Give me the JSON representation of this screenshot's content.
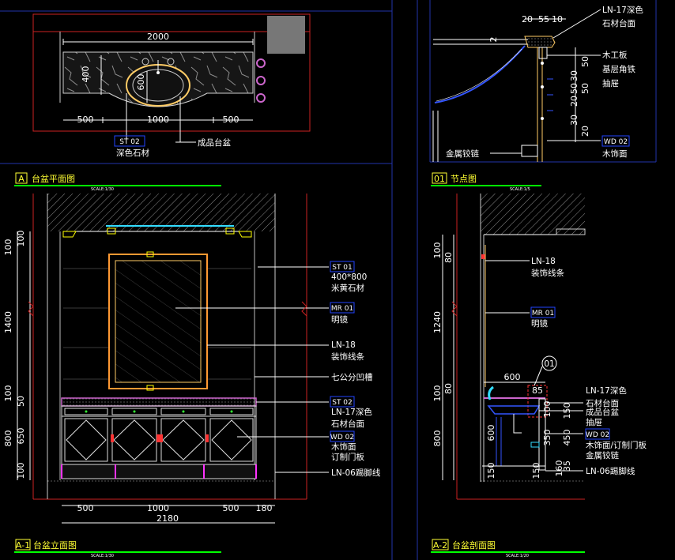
{
  "colors": {
    "background": "#000000",
    "frame": "#2233aa",
    "dimension": "#ffffff",
    "red_line": "#cc2222",
    "tag_box": "#2244ff",
    "title": "#ffff33",
    "title_underline": "#00ff00",
    "countertop": "#cc66cc",
    "accent": "#ffff00"
  },
  "plan": {
    "dims": {
      "width": "2000",
      "depth": "600",
      "side": "400",
      "left": "500",
      "mid": "1000",
      "right": "500"
    },
    "tags": {
      "stone": "ST 02",
      "stone_desc": "深色石材",
      "basin_desc": "成品台盆"
    },
    "title": {
      "id": "A",
      "text": "台盆平面图",
      "scale": "SCALE:1/30"
    }
  },
  "node": {
    "top_dims": [
      "20",
      "55",
      "10"
    ],
    "side_dims": [
      "50",
      "30",
      "50",
      "20",
      "50",
      "30",
      "20"
    ],
    "labels": {
      "top_stone": "LN-17深色",
      "top_stone2": "石材台面",
      "wood": "木工板",
      "angle": "基层角铁",
      "drawer": "抽屉",
      "hinge": "金属铰链",
      "wd_tag": "WD 02",
      "wd_desc": "木饰面",
      "left_dim": "2"
    },
    "title": {
      "id": "01",
      "text": "节点图",
      "scale": "SCALE:1/5"
    }
  },
  "elevation": {
    "vdims_outer": [
      "100",
      "1400",
      "100",
      "800"
    ],
    "vdims_inner": [
      "100",
      "50",
      "650",
      "100"
    ],
    "bottom_dims": [
      "500",
      "1000",
      "500",
      "180"
    ],
    "total": "2180",
    "tags": {
      "st01": "ST 01",
      "st01_size": "400*800",
      "st01_desc": "米黄石材",
      "mr01": "MR 01",
      "mr01_desc": "明镜",
      "ln18": "LN-18",
      "ln18_desc": "装饰线条",
      "groove": "七公分凹槽",
      "st02": "ST 02",
      "st02_desc1": "LN-17深色",
      "st02_desc2": "石材台面",
      "wd02": "WD 02",
      "wd02_desc1": "木饰面",
      "wd02_desc2": "订制门板",
      "kick": "LN-06踢脚线"
    },
    "title": {
      "id": "A-1",
      "text": "台盆立面图",
      "scale": "SCALE:1/30"
    }
  },
  "section": {
    "vdims_outer": [
      "100",
      "1240",
      "100",
      "800"
    ],
    "vdims_inner": [
      "80",
      "80",
      "600",
      "150"
    ],
    "inner_dims": [
      "85",
      "100",
      "350",
      "450",
      "150",
      "150",
      "160",
      "35"
    ],
    "width_dim": "600",
    "callout": "01",
    "tags": {
      "ln18": "LN-18",
      "ln18_desc": "装饰线条",
      "mr01": "MR 01",
      "mr01_desc": "明镜",
      "ln17": "LN-17深色",
      "ln17_desc": "石材台面",
      "basin": "成品台盆",
      "drawer": "抽屉",
      "wd02": "WD 02",
      "wd02_desc1": "木饰面/订制门板",
      "wd02_desc2": "金属铰链",
      "kick": "LN-06踢脚线"
    },
    "title": {
      "id": "A-2",
      "text": "台盆剖面图",
      "scale": "SCALE:1/20"
    }
  }
}
